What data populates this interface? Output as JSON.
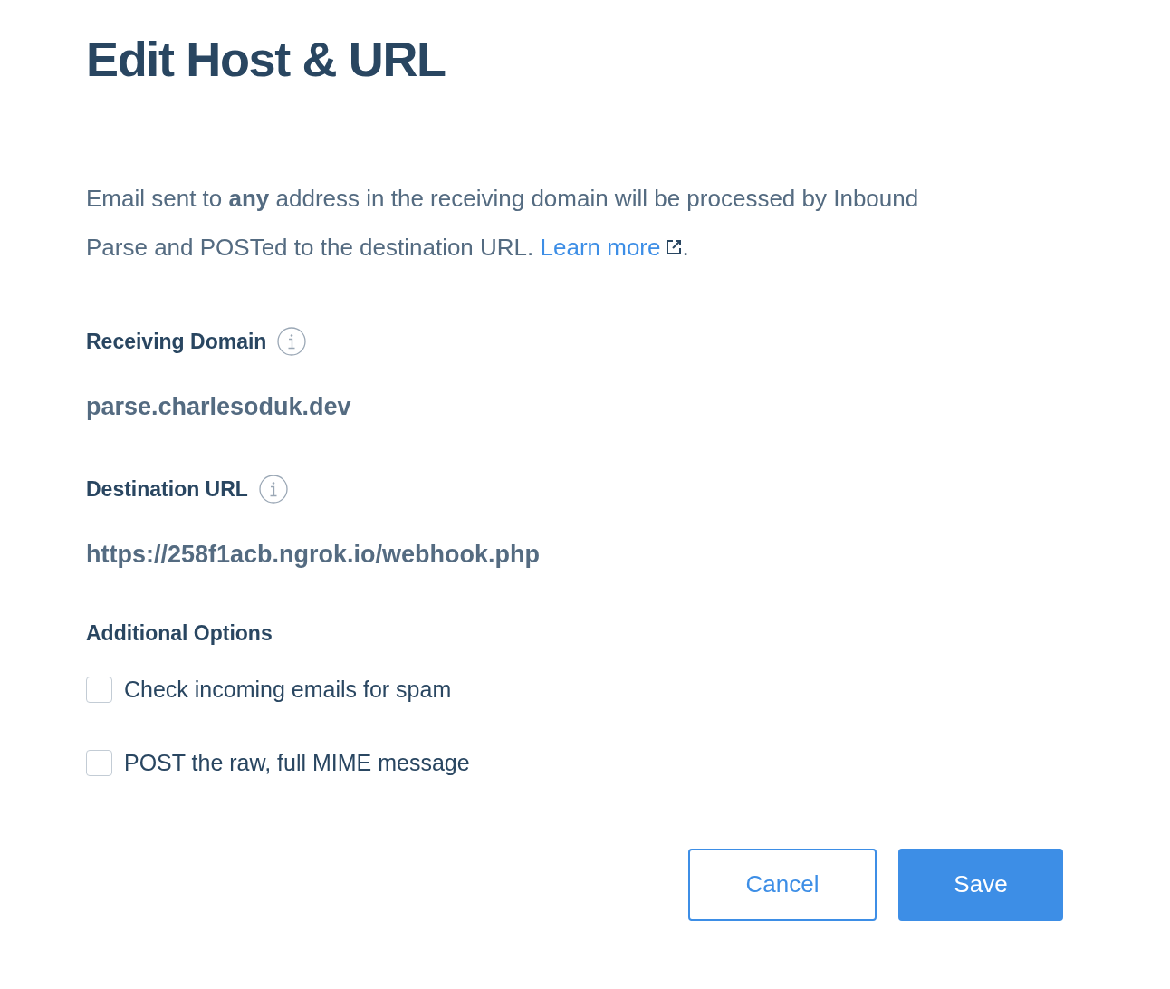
{
  "title": "Edit Host & URL",
  "description": {
    "text": "Email sent to **any** address in the receiving domain will be processed by Inbound Parse and POSTed to the destination URL.",
    "link": "Learn more",
    "suffix": "."
  },
  "fields": [
    {
      "label": "Receiving Domain",
      "value": "parse.charlesoduk.dev"
    },
    {
      "label": "Destination URL",
      "value": "https://258f1acb.ngrok.io/webhook.php"
    }
  ],
  "options": {
    "heading": "Additional Options",
    "items": [
      {
        "label": "Check incoming emails for spam",
        "checked": false
      },
      {
        "label": "POST the raw, full MIME message",
        "checked": false
      }
    ]
  },
  "buttons": [
    {
      "label": "Cancel",
      "kind": "secondary"
    },
    {
      "label": "Save",
      "kind": "primary"
    }
  ]
}
